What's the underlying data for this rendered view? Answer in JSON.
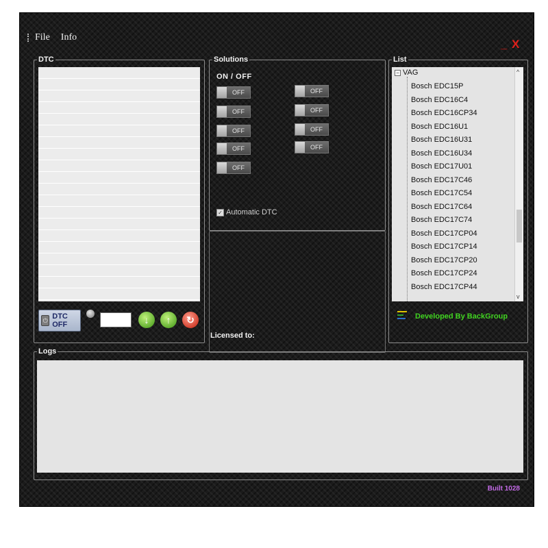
{
  "menu": {
    "file": "File",
    "info": "Info"
  },
  "window_buttons": {
    "minimize": "_",
    "close": "X"
  },
  "dtc": {
    "title": "DTC",
    "off_button": "DTC OFF",
    "search_value": ""
  },
  "solutions": {
    "title": "Solutions",
    "header": "ON / OFF",
    "toggle_label": "OFF",
    "automatic_dtc": {
      "label": "Automatic DTC",
      "checked": true
    }
  },
  "licensed_to": "Licensed to:",
  "list": {
    "title": "List",
    "root": "VAG",
    "items": [
      "Bosch EDC15P",
      "Bosch EDC16C4",
      "Bosch EDC16CP34",
      "Bosch EDC16U1",
      "Bosch EDC16U31",
      "Bosch EDC16U34",
      "Bosch EDC17U01",
      "Bosch EDC17C46",
      "Bosch EDC17C54",
      "Bosch EDC17C64",
      "Bosch EDC17C74",
      "Bosch EDC17CP04",
      "Bosch EDC17CP14",
      "Bosch EDC17CP20",
      "Bosch EDC17CP24",
      "Bosch EDC17CP44"
    ],
    "footer": "Developed By BackGroup"
  },
  "logs": {
    "title": "Logs"
  },
  "built": "Built 1028",
  "colors": {
    "accent_green": "#41d421",
    "built_purple": "#c46ae8",
    "close_red": "#e0201b"
  }
}
